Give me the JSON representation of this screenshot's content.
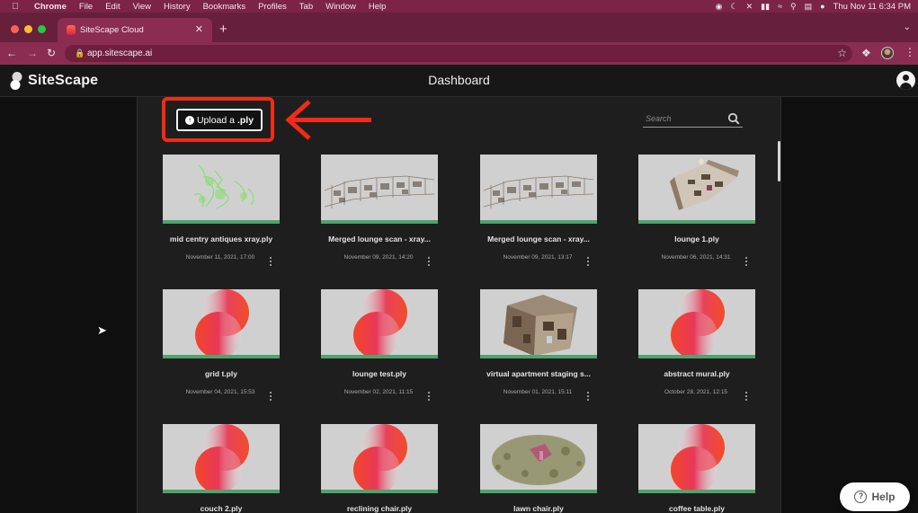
{
  "menubar": {
    "app_name": "Chrome",
    "items": [
      "File",
      "Edit",
      "View",
      "History",
      "Bookmarks",
      "Profiles",
      "Tab",
      "Window",
      "Help"
    ],
    "clock": "Thu Nov 11  6:34 PM"
  },
  "browser": {
    "tab_title": "SiteScape Cloud",
    "url": "app.sitescape.ai"
  },
  "app": {
    "logo_text": "SiteScape",
    "page_title": "Dashboard",
    "upload_label_prefix": "Upload a ",
    "upload_label_ext": ".ply",
    "search_placeholder": "Search",
    "help_label": "Help"
  },
  "files": [
    {
      "name": "mid centry antiques xray.ply",
      "date": "November 11, 2021, 17:00",
      "thumb": "green-xray"
    },
    {
      "name": "Merged lounge scan - xray...",
      "date": "November 09, 2021, 14:20",
      "thumb": "gray-xray"
    },
    {
      "name": "Merged lounge scan - xray...",
      "date": "November 09, 2021, 13:17",
      "thumb": "gray-xray"
    },
    {
      "name": "lounge 1.ply",
      "date": "November 06, 2021, 14:31",
      "thumb": "room-scan"
    },
    {
      "name": "grid t.ply",
      "date": "November 04, 2021, 15:53",
      "thumb": "sitescape-logo"
    },
    {
      "name": "lounge test.ply",
      "date": "November 02, 2021, 11:15",
      "thumb": "sitescape-logo"
    },
    {
      "name": "virtual apartment staging s...",
      "date": "November 01, 2021, 15:11",
      "thumb": "apartment-scan"
    },
    {
      "name": "abstract mural.ply",
      "date": "October 28, 2021, 12:15",
      "thumb": "sitescape-logo"
    },
    {
      "name": "couch 2.ply",
      "date": "",
      "thumb": "sitescape-logo"
    },
    {
      "name": "reclining chair.ply",
      "date": "",
      "thumb": "sitescape-logo"
    },
    {
      "name": "lawn chair.ply",
      "date": "",
      "thumb": "lawn-scan"
    },
    {
      "name": "coffee table.ply",
      "date": "",
      "thumb": "sitescape-logo"
    }
  ],
  "colors": {
    "menubar": "#7b2443",
    "tab_active": "#8a2d51",
    "highlight_red": "#f22a16",
    "thumb_status_bar": "#4fa36c",
    "page_background": "#1e1e1e"
  }
}
